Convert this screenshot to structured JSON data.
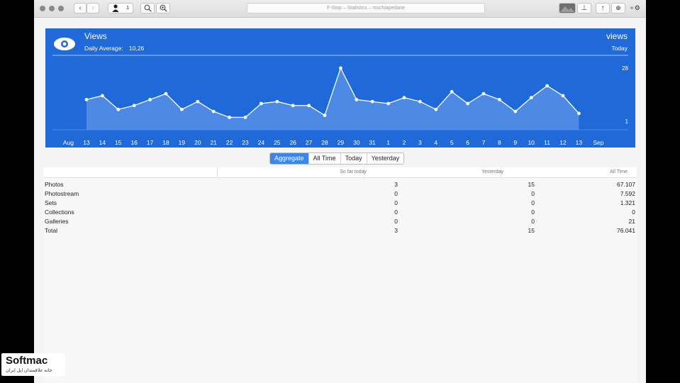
{
  "titlebar": {
    "title": "F-Stop – Statistics – rsschiapedane",
    "user_count": "1"
  },
  "header": {
    "title": "Views",
    "daily_average_label": "Daily Average:",
    "daily_average_value": "10,26",
    "right_title": "views",
    "right_subtitle": "Today"
  },
  "chart_data": {
    "type": "line",
    "x": [
      "13",
      "14",
      "15",
      "16",
      "17",
      "18",
      "19",
      "20",
      "21",
      "22",
      "23",
      "24",
      "25",
      "26",
      "27",
      "28",
      "29",
      "30",
      "31",
      "1",
      "2",
      "3",
      "4",
      "5",
      "6",
      "7",
      "8",
      "9",
      "10",
      "11",
      "12",
      "13"
    ],
    "values": [
      12,
      14,
      7,
      9,
      12,
      15,
      7,
      11,
      6,
      3,
      3,
      10,
      11,
      9,
      9,
      4,
      28,
      12,
      11,
      10,
      13,
      11,
      7,
      16,
      10,
      15,
      12,
      6,
      13,
      19,
      14,
      5
    ],
    "ylim": [
      1,
      28
    ],
    "y_ticks": [
      "28",
      "1"
    ],
    "month_start_label": "Aug",
    "month_end_label": "Sep",
    "colors": {
      "background": "#1f6ad8",
      "line": "#ffffff",
      "fill": "#5c95ea"
    }
  },
  "tabs": [
    {
      "label": "Aggregate",
      "active": true
    },
    {
      "label": "All Time",
      "active": false
    },
    {
      "label": "Today",
      "active": false
    },
    {
      "label": "Yesterday",
      "active": false
    }
  ],
  "table": {
    "columns": [
      "So far today",
      "Yesterday",
      "All Time"
    ],
    "rows": [
      {
        "label": "Photos",
        "today": "3",
        "yesterday": "15",
        "all_time": "67.107"
      },
      {
        "label": "Photostream",
        "today": "0",
        "yesterday": "0",
        "all_time": "7.592"
      },
      {
        "label": "Sets",
        "today": "0",
        "yesterday": "0",
        "all_time": "1.321"
      },
      {
        "label": "Collections",
        "today": "0",
        "yesterday": "0",
        "all_time": "0"
      },
      {
        "label": "Galleries",
        "today": "0",
        "yesterday": "0",
        "all_time": "21"
      },
      {
        "label": "Total",
        "today": "3",
        "yesterday": "15",
        "all_time": "76.041"
      }
    ]
  },
  "watermark": {
    "brand": "Softmac",
    "tagline": "خانه علاقمندان اپل ایران"
  }
}
